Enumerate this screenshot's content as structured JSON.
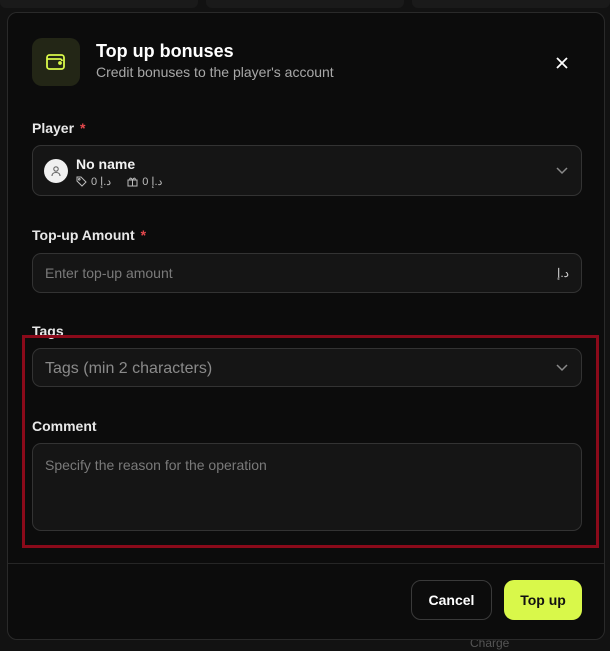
{
  "dialog": {
    "title": "Top up bonuses",
    "subtitle": "Credit bonuses to the player's account",
    "icon": "wallet-icon",
    "close_icon": "close-icon"
  },
  "player": {
    "label": "Player",
    "required_mark": "*",
    "name": "No name",
    "stat1": "د.إ 0",
    "stat2": "د.إ 0",
    "avatar_icon": "user-icon",
    "stat1_icon": "tag-icon",
    "stat2_icon": "gift-icon"
  },
  "amount": {
    "label": "Top-up Amount",
    "required_mark": "*",
    "placeholder": "Enter top-up amount",
    "currency": "د.إ"
  },
  "tags": {
    "label": "Tags",
    "placeholder": "Tags (min 2 characters)"
  },
  "comment": {
    "label": "Comment",
    "placeholder": "Specify the reason for the operation"
  },
  "actions": {
    "cancel": "Cancel",
    "submit": "Top up"
  },
  "background": {
    "charge_label": "Charge"
  },
  "colors": {
    "accent": "#d9f84a",
    "required": "#e5484d",
    "highlight": "#8b0a1a",
    "panel": "#0c0c0c"
  }
}
